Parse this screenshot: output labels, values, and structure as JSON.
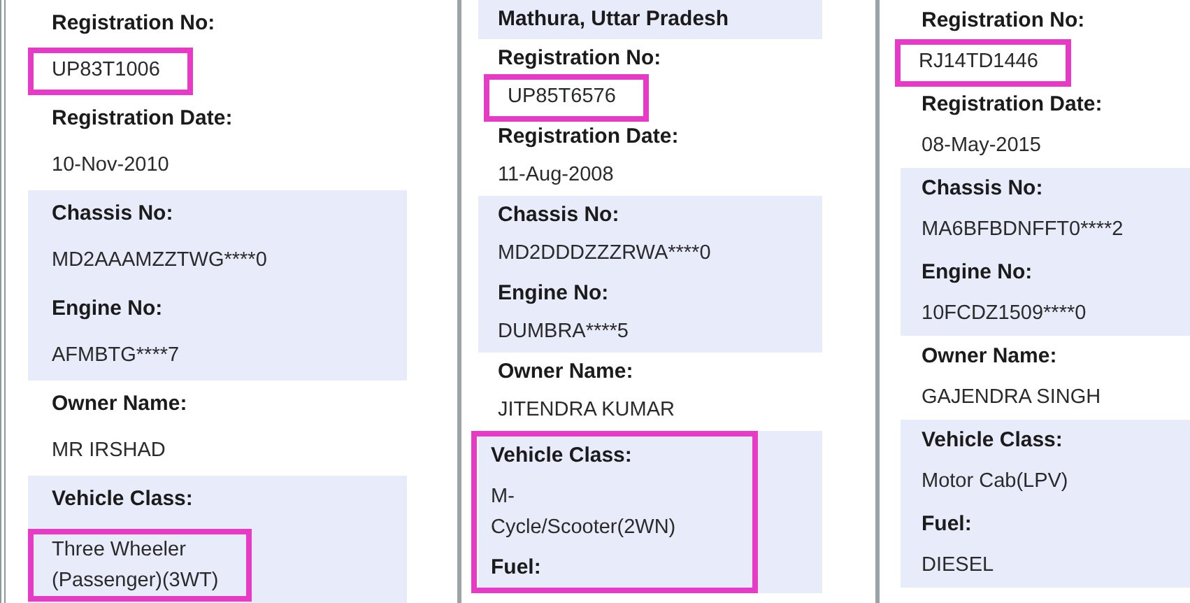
{
  "panels": [
    {
      "groups": [
        {
          "shaded": false,
          "boxed": false,
          "lines": [
            {
              "kind": "label",
              "text": "Registration No:",
              "boxed": false
            },
            {
              "kind": "value",
              "text": "UP83T1006",
              "boxed": true
            },
            {
              "kind": "label",
              "text": "Registration Date:",
              "boxed": false
            },
            {
              "kind": "value",
              "text": "10-Nov-2010",
              "boxed": false
            }
          ]
        },
        {
          "shaded": true,
          "boxed": false,
          "lines": [
            {
              "kind": "label",
              "text": "Chassis No:",
              "boxed": false
            },
            {
              "kind": "value",
              "text": "MD2AAAMZZTWG****0",
              "boxed": false
            },
            {
              "kind": "label",
              "text": "Engine No:",
              "boxed": false
            },
            {
              "kind": "value",
              "text": "AFMBTG****7",
              "boxed": false
            }
          ]
        },
        {
          "shaded": false,
          "boxed": false,
          "lines": [
            {
              "kind": "label",
              "text": "Owner Name:",
              "boxed": false
            },
            {
              "kind": "value",
              "text": "MR IRSHAD",
              "boxed": false
            }
          ]
        },
        {
          "shaded": true,
          "boxed": false,
          "lines": [
            {
              "kind": "label",
              "text": "Vehicle Class:",
              "boxed": false
            },
            {
              "kind": "value",
              "text": "Three Wheeler\n(Passenger)(3WT)",
              "boxed": true
            }
          ]
        }
      ]
    },
    {
      "groups": [
        {
          "shaded": true,
          "boxed": false,
          "lines": [
            {
              "kind": "label",
              "text": "Mathura, Uttar Pradesh",
              "boxed": false
            }
          ]
        },
        {
          "shaded": false,
          "boxed": false,
          "lines": [
            {
              "kind": "label",
              "text": "Registration No:",
              "boxed": false
            },
            {
              "kind": "value",
              "text": "UP85T6576",
              "boxed": true
            },
            {
              "kind": "label",
              "text": "Registration Date:",
              "boxed": false
            },
            {
              "kind": "value",
              "text": "11-Aug-2008",
              "boxed": false
            }
          ]
        },
        {
          "shaded": true,
          "boxed": false,
          "lines": [
            {
              "kind": "label",
              "text": "Chassis No:",
              "boxed": false
            },
            {
              "kind": "value",
              "text": "MD2DDDZZZRWA****0",
              "boxed": false
            },
            {
              "kind": "label",
              "text": "Engine No:",
              "boxed": false
            },
            {
              "kind": "value",
              "text": "DUMBRA****5",
              "boxed": false
            }
          ]
        },
        {
          "shaded": false,
          "boxed": false,
          "lines": [
            {
              "kind": "label",
              "text": "Owner Name:",
              "boxed": false
            },
            {
              "kind": "value",
              "text": "JITENDRA KUMAR",
              "boxed": false
            }
          ]
        },
        {
          "shaded": true,
          "boxed": true,
          "lines": [
            {
              "kind": "label",
              "text": "Vehicle Class:",
              "boxed": false
            },
            {
              "kind": "value",
              "text": "M-\nCycle/Scooter(2WN)",
              "boxed": false
            },
            {
              "kind": "label",
              "text": "Fuel:",
              "boxed": false
            }
          ]
        }
      ]
    },
    {
      "groups": [
        {
          "shaded": false,
          "boxed": false,
          "lines": [
            {
              "kind": "label",
              "text": "Registration No:",
              "boxed": false
            },
            {
              "kind": "value",
              "text": "RJ14TD1446",
              "boxed": true
            },
            {
              "kind": "label",
              "text": "Registration Date:",
              "boxed": false
            },
            {
              "kind": "value",
              "text": "08-May-2015",
              "boxed": false
            }
          ]
        },
        {
          "shaded": true,
          "boxed": false,
          "lines": [
            {
              "kind": "label",
              "text": "Chassis No:",
              "boxed": false
            },
            {
              "kind": "value",
              "text": "MA6BFBDNFFT0****2",
              "boxed": false
            },
            {
              "kind": "label",
              "text": "Engine No:",
              "boxed": false
            },
            {
              "kind": "value",
              "text": "10FCDZ1509****0",
              "boxed": false
            }
          ]
        },
        {
          "shaded": false,
          "boxed": false,
          "lines": [
            {
              "kind": "label",
              "text": "Owner Name:",
              "boxed": false
            },
            {
              "kind": "value",
              "text": "GAJENDRA SINGH",
              "boxed": false
            }
          ]
        },
        {
          "shaded": true,
          "boxed": false,
          "lines": [
            {
              "kind": "label",
              "text": "Vehicle Class:",
              "boxed": false
            },
            {
              "kind": "value",
              "text": "Motor Cab(LPV)",
              "boxed": false
            },
            {
              "kind": "label",
              "text": "Fuel:",
              "boxed": false
            },
            {
              "kind": "value",
              "text": "DIESEL",
              "boxed": false
            }
          ]
        }
      ]
    }
  ]
}
